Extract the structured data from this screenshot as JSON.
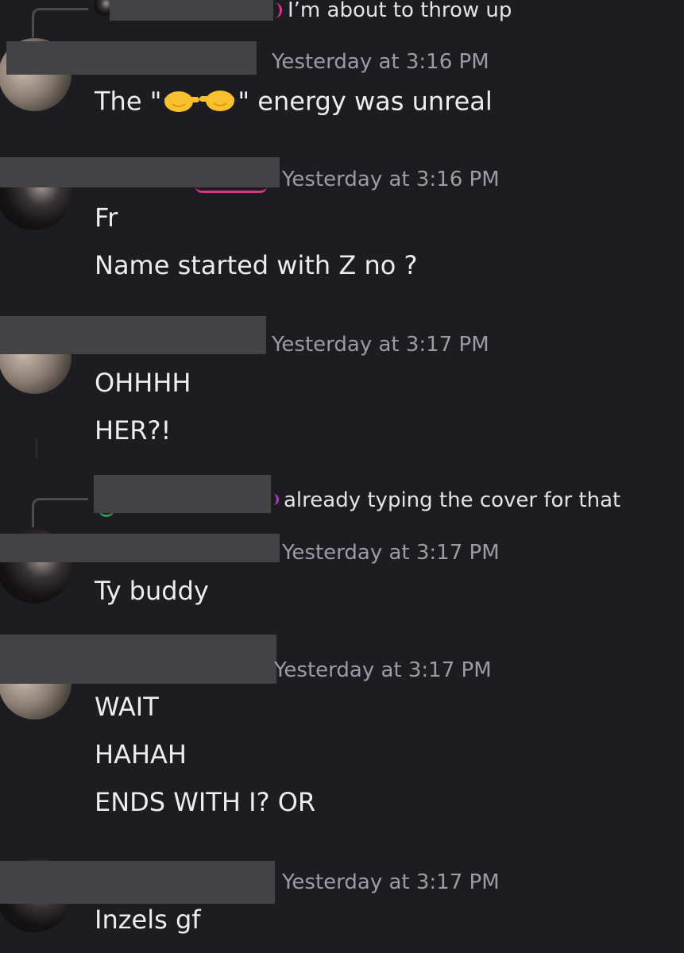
{
  "messages": [
    {
      "reply_text": "I’m about to throw up",
      "timestamp": "Yesterday at 3:16 PM",
      "lines": [
        "The \"",
        "\" energy was unreal"
      ]
    },
    {
      "timestamp": "Yesterday at 3:16 PM",
      "lines": [
        "Fr",
        "Name started with Z no ?"
      ]
    },
    {
      "timestamp": "Yesterday at 3:17 PM",
      "lines": [
        "OHHHH",
        "HER?!"
      ]
    },
    {
      "reply_text": "already typing the cover for that",
      "timestamp": "Yesterday at 3:17 PM",
      "lines": [
        "Ty buddy"
      ]
    },
    {
      "timestamp": "Yesterday at 3:17 PM",
      "lines": [
        "WAIT",
        "HAHAH",
        "ENDS WITH I? OR"
      ]
    },
    {
      "timestamp": "Yesterday at 3:17 PM",
      "lines": [
        "Inzels gf"
      ]
    }
  ],
  "icons": {
    "emoji": "hands-pointing-emoji",
    "avatar_light": "avatar-light",
    "avatar_dark": "avatar-dark"
  },
  "colors": {
    "background": "#1c1c21",
    "redaction": "#434346",
    "timestamp": "#9c9ca6",
    "text": "#ececf1",
    "name_accent_pink": "#e0338f"
  }
}
